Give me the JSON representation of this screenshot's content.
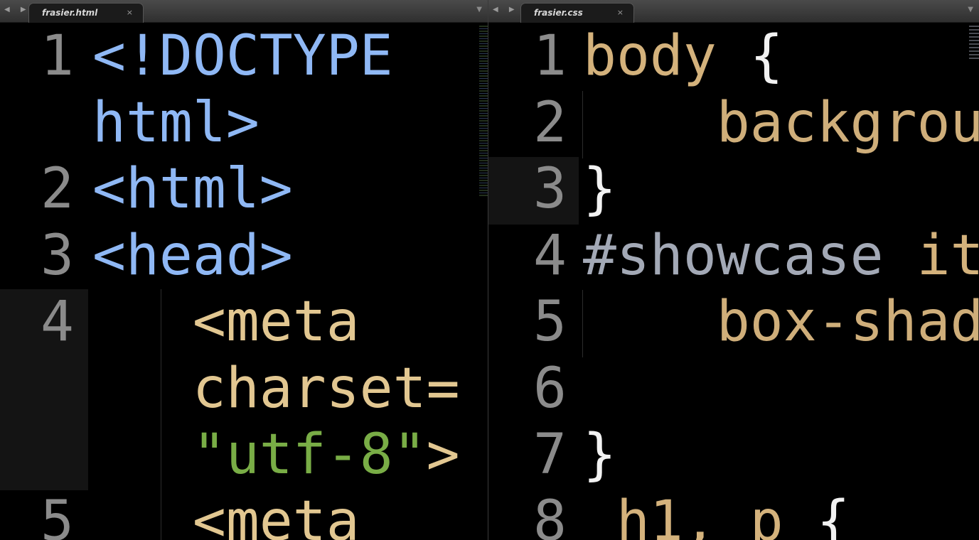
{
  "left_pane": {
    "tab": {
      "label": "frasier.html",
      "close": "×"
    },
    "nav_arrows": "◀ ▶",
    "dropdown": "▼",
    "lines": [
      {
        "number": "1",
        "segments": [
          {
            "text": "<!DOCTYPE",
            "cls": "tag"
          }
        ]
      },
      {
        "number": "",
        "segments": [
          {
            "text": "html>",
            "cls": "tag"
          }
        ]
      },
      {
        "number": "2",
        "segments": [
          {
            "text": "<html>",
            "cls": "tag"
          }
        ]
      },
      {
        "number": "3",
        "segments": [
          {
            "text": "<head>",
            "cls": "tag"
          }
        ]
      },
      {
        "number": "4",
        "segments": [
          {
            "text": "   <meta",
            "cls": "attr"
          }
        ]
      },
      {
        "number": "",
        "segments": [
          {
            "text": "   charset=",
            "cls": "attr"
          }
        ]
      },
      {
        "number": "",
        "segments": [
          {
            "text": "   ",
            "cls": "attr"
          },
          {
            "text": "\"utf-8\"",
            "cls": "str"
          },
          {
            "text": ">",
            "cls": "attr"
          }
        ]
      },
      {
        "number": "5",
        "segments": [
          {
            "text": "   <meta",
            "cls": "attr"
          }
        ]
      }
    ]
  },
  "right_pane": {
    "tab": {
      "label": "frasier.css",
      "close": "×"
    },
    "nav_arrows": "◀ ▶",
    "dropdown": "▼",
    "lines": [
      {
        "number": "1",
        "segments": [
          {
            "text": "body",
            "cls": "sel"
          },
          {
            "text": " {",
            "cls": "brace"
          }
        ]
      },
      {
        "number": "2",
        "segments": [
          {
            "text": "    backgrou",
            "cls": "prop"
          }
        ]
      },
      {
        "number": "3",
        "segments": [
          {
            "text": "}",
            "cls": "brace"
          }
        ]
      },
      {
        "number": "4",
        "segments": [
          {
            "text": "#showcase",
            "cls": "idsel"
          },
          {
            "text": " it",
            "cls": "sel"
          }
        ]
      },
      {
        "number": "5",
        "segments": [
          {
            "text": "    box-shad",
            "cls": "prop"
          }
        ]
      },
      {
        "number": "6",
        "segments": [
          {
            "text": "",
            "cls": "prop"
          }
        ]
      },
      {
        "number": "7",
        "segments": [
          {
            "text": "}",
            "cls": "brace"
          }
        ]
      },
      {
        "number": "8",
        "segments": [
          {
            "text": " h1, p ",
            "cls": "sel"
          },
          {
            "text": "{",
            "cls": "brace"
          }
        ]
      }
    ]
  }
}
